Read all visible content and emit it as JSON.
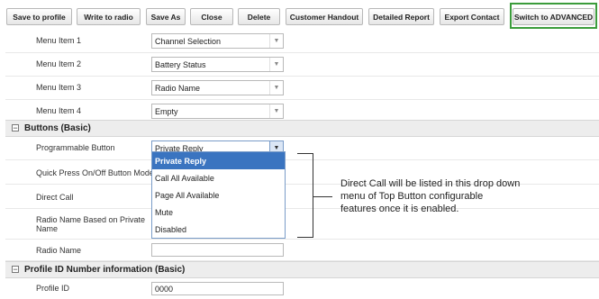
{
  "toolbar": {
    "buttons": [
      {
        "label": "Save to profile"
      },
      {
        "label": "Write to radio"
      },
      {
        "label": "Save As"
      },
      {
        "label": "Close"
      },
      {
        "label": "Delete"
      },
      {
        "label": "Customer Handout"
      },
      {
        "label": "Detailed Report"
      },
      {
        "label": "Export Contact"
      },
      {
        "label": "Switch to ADVANCED"
      }
    ]
  },
  "menu_items": [
    {
      "label": "Menu Item 1",
      "value": "Channel Selection"
    },
    {
      "label": "Menu Item 2",
      "value": "Battery Status"
    },
    {
      "label": "Menu Item 3",
      "value": "Radio Name"
    },
    {
      "label": "Menu Item 4",
      "value": "Empty"
    }
  ],
  "buttons_section": {
    "title": "Buttons (Basic)",
    "toggle": "−",
    "programmable_button": {
      "label": "Programmable Button",
      "value": "Private Reply"
    },
    "quick_press": {
      "label": "Quick Press On/Off Button Mode"
    },
    "direct_call": {
      "label": "Direct Call"
    },
    "radio_name_private": {
      "label": "Radio Name Based on Private Name"
    },
    "radio_name": {
      "label": "Radio Name",
      "value": ""
    },
    "dropdown_options": [
      "Private Reply",
      "Call All Available",
      "Page All Available",
      "Mute",
      "Disabled"
    ],
    "dropdown_selected": "Private Reply"
  },
  "profile_section": {
    "title": "Profile ID Number information (Basic)",
    "toggle": "−",
    "profile_id": {
      "label": "Profile ID",
      "value": "0000"
    }
  },
  "callout": {
    "text": "Direct Call will be listed in this drop down menu of Top Button configurable features once it is enabled."
  },
  "colors": {
    "advanced_highlight": "#3c9c3c",
    "dropdown_selected": "#3a74c0"
  }
}
